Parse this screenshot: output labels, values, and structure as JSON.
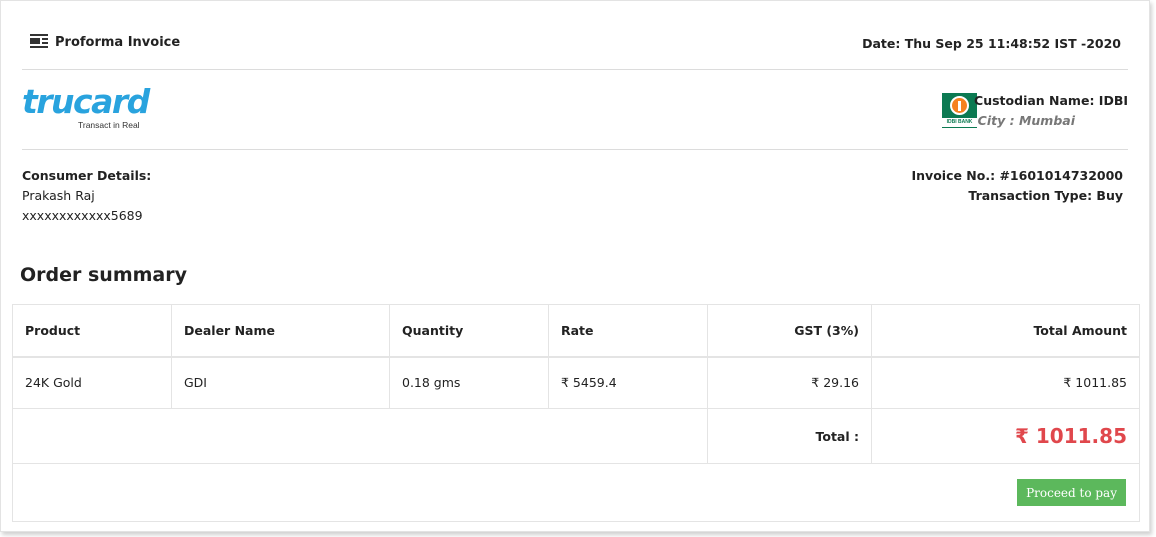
{
  "header": {
    "title": "Proforma Invoice",
    "date": "Date: Thu Sep 25 11:48:52 IST -2020"
  },
  "brand": {
    "logo_word": "trucard",
    "logo_tagline": "Transact in Real",
    "bank_logo_text": "IDBI BANK",
    "custodian": "Custodian Name: IDBI",
    "city": "City : Mumbai"
  },
  "consumer": {
    "label": "Consumer Details:",
    "name": "Prakash Raj",
    "account": "xxxxxxxxxxxx5689"
  },
  "invoice": {
    "number": "Invoice No.: #1601014732000",
    "transaction_type": "Transaction Type: Buy"
  },
  "summary": {
    "heading": "Order summary",
    "columns": [
      "Product",
      "Dealer Name",
      "Quantity",
      "Rate",
      "GST (3%)",
      "Total Amount"
    ],
    "rows": [
      {
        "product": "24K Gold",
        "dealer": "GDI",
        "quantity": "0.18 gms",
        "rate": "₹ 5459.4",
        "gst": "₹ 29.16",
        "total": "₹ 1011.85"
      }
    ],
    "total_label": "Total :",
    "total_value": "₹ 1011.85"
  },
  "actions": {
    "proceed_label": "Proceed to pay"
  },
  "colors": {
    "total_accent": "#e0474c",
    "button": "#5cb85c",
    "brand_blue": "#29a3de",
    "bank_green": "#0c7a52"
  }
}
